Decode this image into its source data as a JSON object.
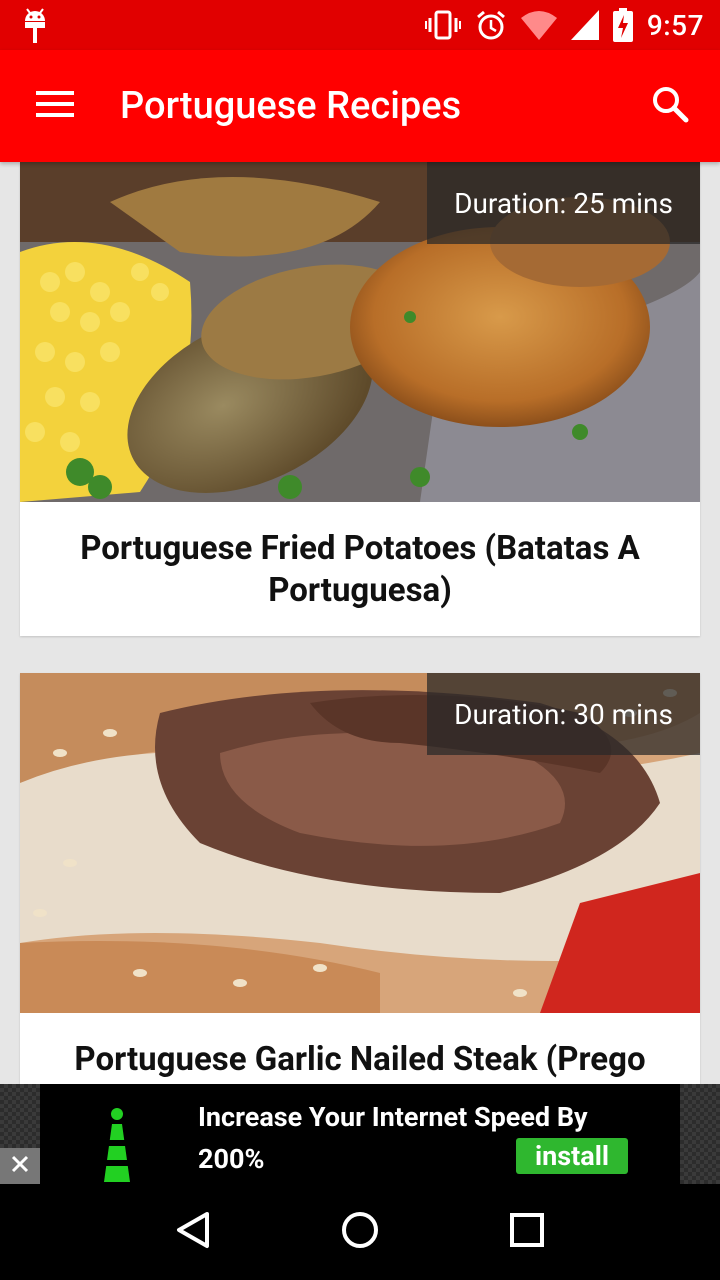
{
  "status_bar": {
    "time": "9:57",
    "icons": [
      "android-debug-icon",
      "vibrate-icon",
      "alarm-icon",
      "wifi-icon",
      "signal-icon",
      "battery-charging-icon"
    ]
  },
  "app_bar": {
    "title": "Portuguese Recipes",
    "menu_icon": "hamburger-menu-icon",
    "search_icon": "search-icon"
  },
  "recipes": [
    {
      "title": "Portuguese Fried Potatoes (Batatas A Portuguesa)",
      "duration": "Duration: 25 mins"
    },
    {
      "title": "Portuguese Garlic Nailed Steak (Prego",
      "duration": "Duration: 30 mins"
    }
  ],
  "ad": {
    "headline_line1": "Increase Your Internet Speed By",
    "headline_line2": "200%",
    "button_label": "install",
    "close_icon": "close-icon"
  },
  "nav_bar": {
    "back_icon": "back-triangle-icon",
    "home_icon": "home-circle-icon",
    "recents_icon": "recents-square-icon"
  },
  "colors": {
    "status_bar": "#e10000",
    "app_bar": "#ff0000",
    "background": "#e6e6e6",
    "install_green": "#2fb72f"
  }
}
